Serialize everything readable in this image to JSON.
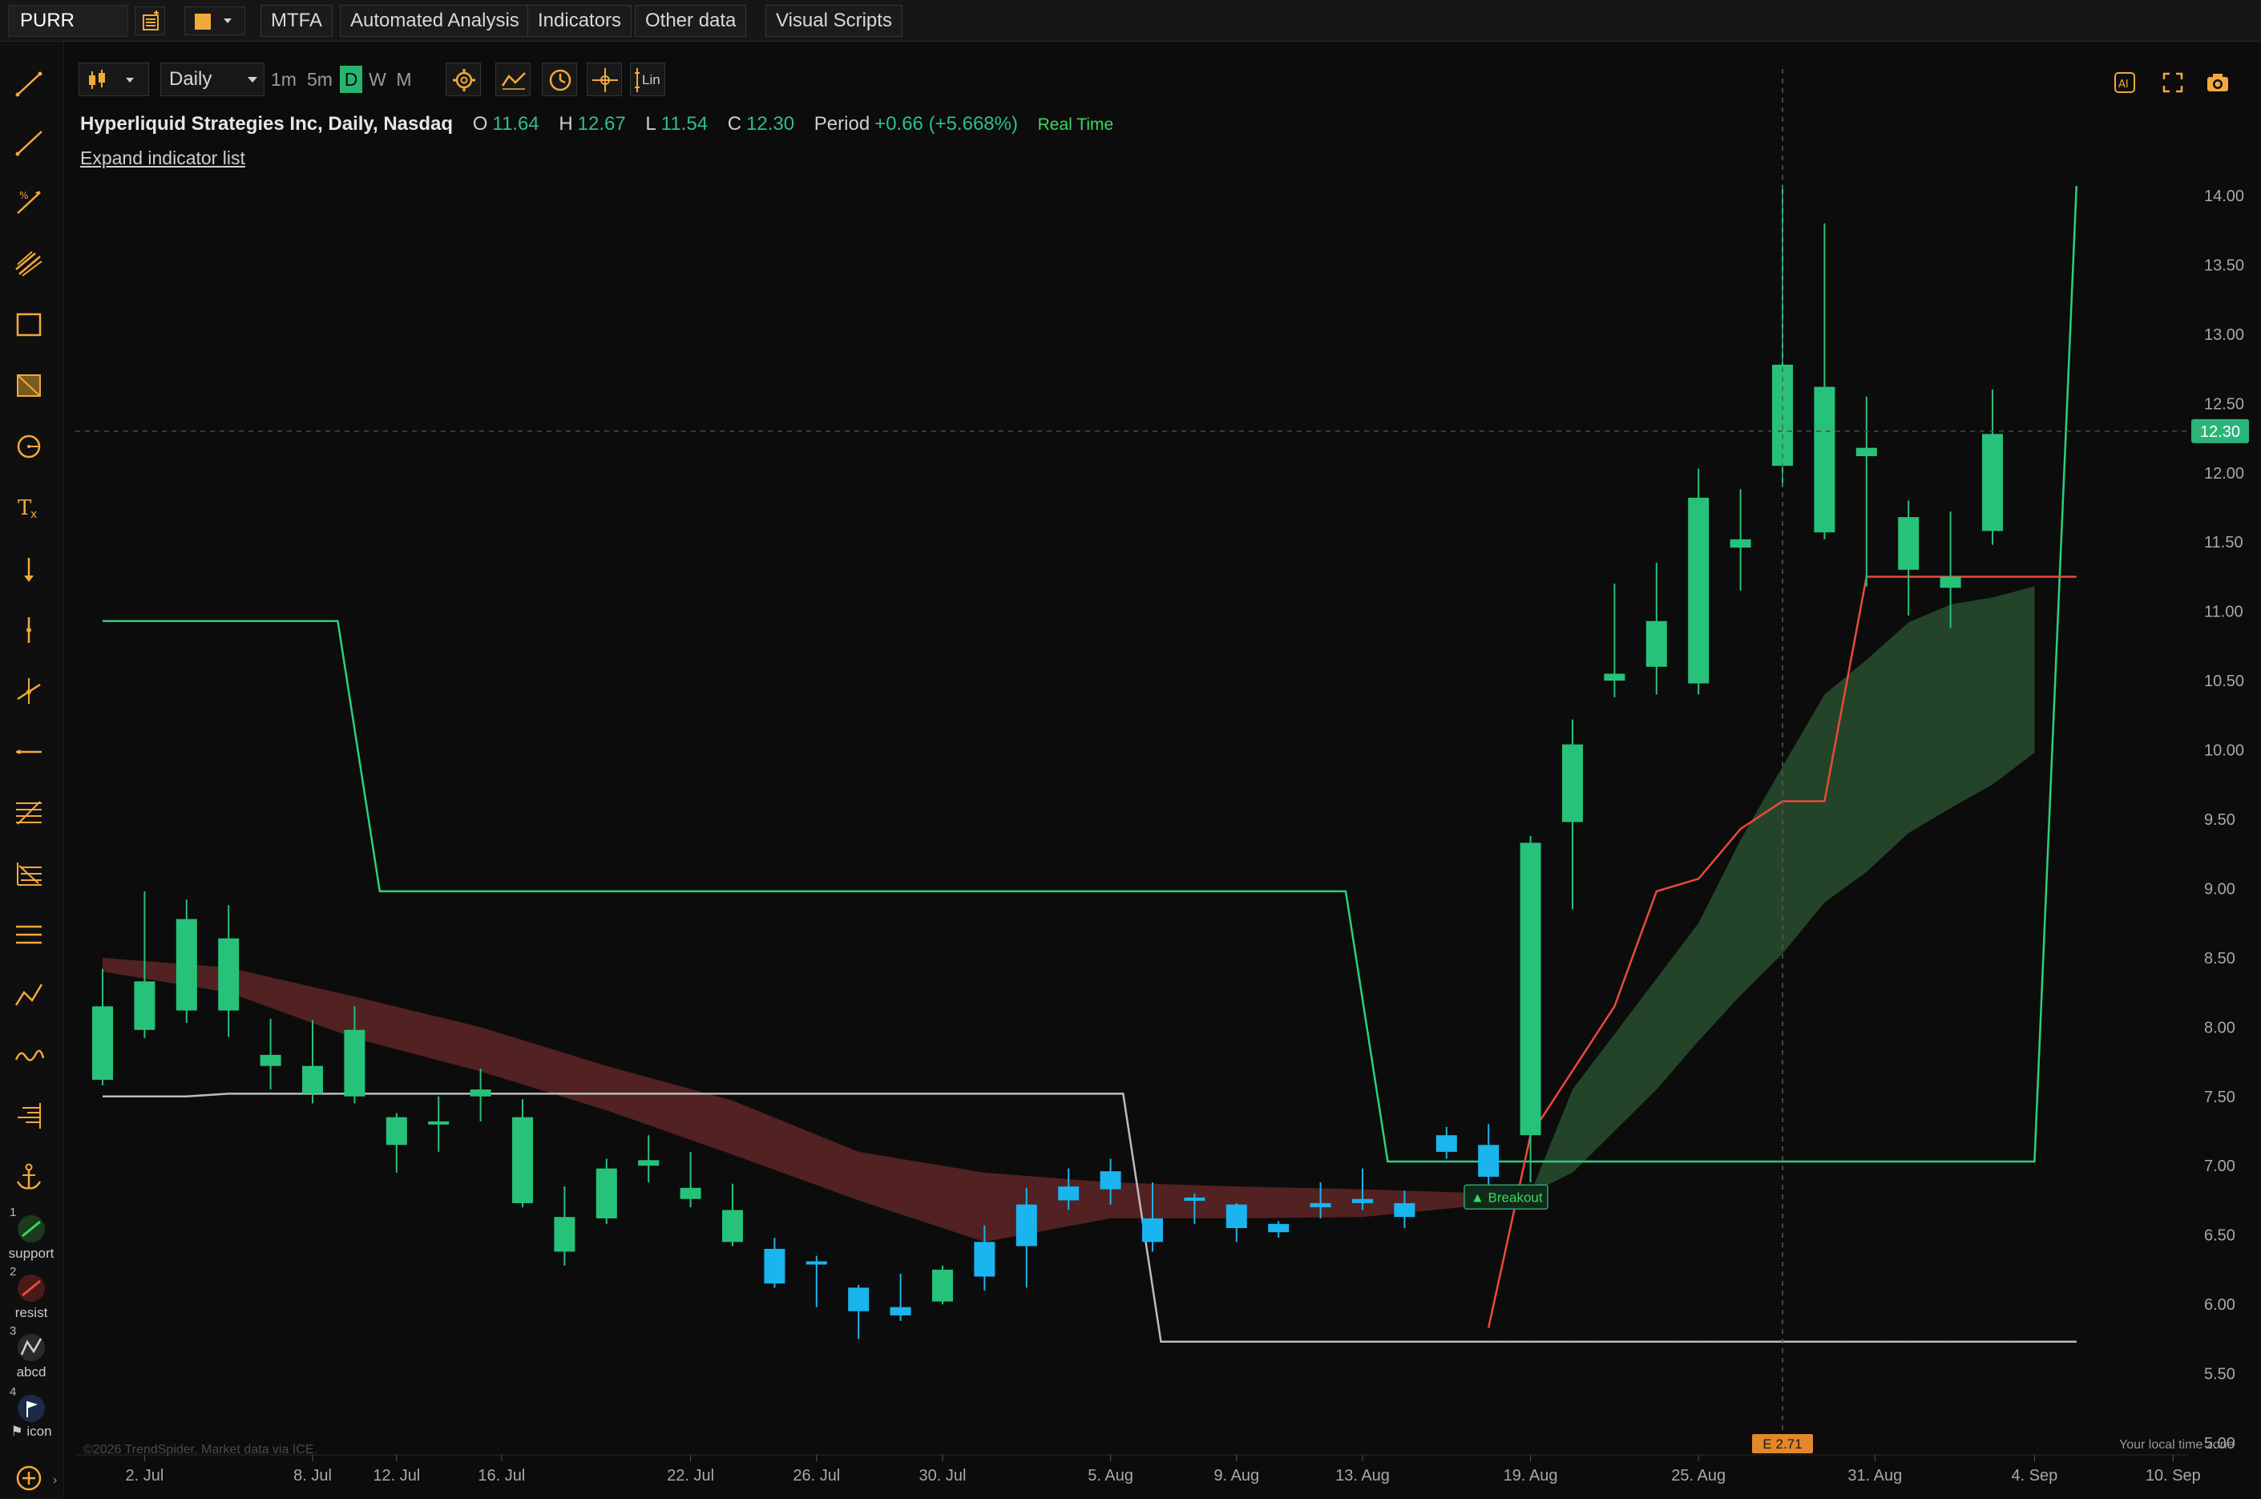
{
  "topbar": {
    "ticker": "PURR",
    "buttons": [
      "MTFA",
      "Automated Analysis",
      "Indicators",
      "Other data",
      "Visual Scripts"
    ]
  },
  "toolbar": {
    "interval": "Daily",
    "timeframes": [
      "1m",
      "5m",
      "D",
      "W",
      "M"
    ],
    "active_timeframe": "D",
    "scale_label": "Lin"
  },
  "info": {
    "name": "Hyperliquid Strategies Inc, Daily, Nasdaq",
    "o_label": "O",
    "o": "11.64",
    "h_label": "H",
    "h": "12.67",
    "l_label": "L",
    "l": "11.54",
    "c_label": "C",
    "c": "12.30",
    "period_label": "Period",
    "period": "+0.66 (+5.668%)",
    "realtime": "Real Time",
    "expand_link": "Expand indicator list"
  },
  "favorites": [
    {
      "num": "1",
      "label": "support"
    },
    {
      "num": "2",
      "label": "resist"
    },
    {
      "num": "3",
      "label": "abcd"
    },
    {
      "num": "4",
      "label": "icon"
    }
  ],
  "footer": {
    "copyright": "©2026 TrendSpider. Market data via ICE.",
    "local_tz": "Your local time zone"
  },
  "colors": {
    "up": "#27c27a",
    "down_blue": "#1ab4ee",
    "cloud_red": "#5a2424",
    "cloud_green": "#274a2c",
    "channel": "#2bd07e",
    "stop_red": "#ea4a3a",
    "gray_line": "#bcbcbc",
    "accent": "#f2a93b"
  },
  "chart_data": {
    "type": "candlestick",
    "ylim": [
      5.0,
      14.2
    ],
    "yticks": [
      "14.00",
      "13.50",
      "13.00",
      "12.50",
      "12.00",
      "11.50",
      "11.00",
      "10.50",
      "10.00",
      "9.50",
      "9.00",
      "8.50",
      "8.00",
      "7.50",
      "7.00",
      "6.50",
      "6.00",
      "5.50",
      "5.00"
    ],
    "xticks": [
      {
        "label": "2. Jul",
        "i": 1
      },
      {
        "label": "8. Jul",
        "i": 5
      },
      {
        "label": "12. Jul",
        "i": 7
      },
      {
        "label": "16. Jul",
        "i": 9.5
      },
      {
        "label": "22. Jul",
        "i": 14
      },
      {
        "label": "26. Jul",
        "i": 17
      },
      {
        "label": "30. Jul",
        "i": 20
      },
      {
        "label": "5. Aug",
        "i": 24
      },
      {
        "label": "9. Aug",
        "i": 27
      },
      {
        "label": "13. Aug",
        "i": 30
      },
      {
        "label": "19. Aug",
        "i": 34
      },
      {
        "label": "25. Aug",
        "i": 38
      },
      {
        "label": "31. Aug",
        "i": 42.2
      },
      {
        "label": "4. Sep",
        "i": 46
      },
      {
        "label": "10. Sep",
        "i": 49.3
      }
    ],
    "candles": [
      {
        "o": 7.62,
        "h": 8.42,
        "l": 7.58,
        "c": 8.15,
        "k": "up"
      },
      {
        "o": 7.98,
        "h": 8.98,
        "l": 7.92,
        "c": 8.33,
        "k": "up"
      },
      {
        "o": 8.12,
        "h": 8.92,
        "l": 8.03,
        "c": 8.78,
        "k": "up"
      },
      {
        "o": 8.12,
        "h": 8.88,
        "l": 7.93,
        "c": 8.64,
        "k": "up"
      },
      {
        "o": 7.8,
        "h": 8.06,
        "l": 7.55,
        "c": 7.72,
        "k": "up"
      },
      {
        "o": 7.52,
        "h": 8.05,
        "l": 7.45,
        "c": 7.72,
        "k": "up"
      },
      {
        "o": 7.5,
        "h": 8.15,
        "l": 7.45,
        "c": 7.98,
        "k": "up"
      },
      {
        "o": 7.35,
        "h": 7.38,
        "l": 6.95,
        "c": 7.15,
        "k": "up"
      },
      {
        "o": 7.3,
        "h": 7.5,
        "l": 7.1,
        "c": 7.32,
        "k": "up"
      },
      {
        "o": 7.55,
        "h": 7.7,
        "l": 7.32,
        "c": 7.5,
        "k": "up"
      },
      {
        "o": 6.73,
        "h": 7.48,
        "l": 6.7,
        "c": 7.35,
        "k": "up"
      },
      {
        "o": 6.63,
        "h": 6.85,
        "l": 6.28,
        "c": 6.38,
        "k": "up"
      },
      {
        "o": 6.62,
        "h": 7.05,
        "l": 6.58,
        "c": 6.98,
        "k": "up"
      },
      {
        "o": 7.0,
        "h": 7.22,
        "l": 6.88,
        "c": 7.04,
        "k": "up"
      },
      {
        "o": 6.76,
        "h": 7.1,
        "l": 6.7,
        "c": 6.84,
        "k": "up"
      },
      {
        "o": 6.68,
        "h": 6.87,
        "l": 6.42,
        "c": 6.45,
        "k": "up"
      },
      {
        "o": 6.4,
        "h": 6.48,
        "l": 6.12,
        "c": 6.15,
        "k": "blue"
      },
      {
        "o": 6.31,
        "h": 6.35,
        "l": 5.98,
        "c": 6.3,
        "k": "blue"
      },
      {
        "o": 6.12,
        "h": 6.14,
        "l": 5.75,
        "c": 5.95,
        "k": "blue"
      },
      {
        "o": 5.92,
        "h": 6.22,
        "l": 5.88,
        "c": 5.98,
        "k": "blue"
      },
      {
        "o": 6.02,
        "h": 6.28,
        "l": 6.0,
        "c": 6.25,
        "k": "up"
      },
      {
        "o": 6.45,
        "h": 6.57,
        "l": 6.1,
        "c": 6.2,
        "k": "blue"
      },
      {
        "o": 6.72,
        "h": 6.84,
        "l": 6.12,
        "c": 6.42,
        "k": "blue"
      },
      {
        "o": 6.85,
        "h": 6.98,
        "l": 6.68,
        "c": 6.75,
        "k": "blue"
      },
      {
        "o": 6.96,
        "h": 7.05,
        "l": 6.72,
        "c": 6.83,
        "k": "blue"
      },
      {
        "o": 6.62,
        "h": 6.88,
        "l": 6.38,
        "c": 6.45,
        "k": "blue"
      },
      {
        "o": 6.77,
        "h": 6.8,
        "l": 6.58,
        "c": 6.76,
        "k": "blue"
      },
      {
        "o": 6.72,
        "h": 6.73,
        "l": 6.45,
        "c": 6.55,
        "k": "blue"
      },
      {
        "o": 6.58,
        "h": 6.6,
        "l": 6.48,
        "c": 6.52,
        "k": "blue"
      },
      {
        "o": 6.73,
        "h": 6.88,
        "l": 6.62,
        "c": 6.7,
        "k": "blue"
      },
      {
        "o": 6.76,
        "h": 6.98,
        "l": 6.68,
        "c": 6.73,
        "k": "blue"
      },
      {
        "o": 6.73,
        "h": 6.82,
        "l": 6.55,
        "c": 6.63,
        "k": "blue"
      },
      {
        "o": 7.22,
        "h": 7.28,
        "l": 7.05,
        "c": 7.1,
        "k": "blue"
      },
      {
        "o": 7.15,
        "h": 7.3,
        "l": 6.85,
        "c": 6.92,
        "k": "blue"
      },
      {
        "o": 7.22,
        "h": 9.38,
        "l": 6.88,
        "c": 9.33,
        "k": "up"
      },
      {
        "o": 9.48,
        "h": 10.22,
        "l": 8.85,
        "c": 10.04,
        "k": "up"
      },
      {
        "o": 10.5,
        "h": 11.2,
        "l": 10.38,
        "c": 10.55,
        "k": "up"
      },
      {
        "o": 10.6,
        "h": 11.35,
        "l": 10.4,
        "c": 10.93,
        "k": "up"
      },
      {
        "o": 10.48,
        "h": 12.03,
        "l": 10.4,
        "c": 11.82,
        "k": "up"
      },
      {
        "o": 11.46,
        "h": 11.88,
        "l": 11.15,
        "c": 11.52,
        "k": "up"
      },
      {
        "o": 12.05,
        "h": 14.07,
        "l": 11.9,
        "c": 12.78,
        "k": "up"
      },
      {
        "o": 11.57,
        "h": 13.8,
        "l": 11.52,
        "c": 12.62,
        "k": "up"
      },
      {
        "o": 12.18,
        "h": 12.55,
        "l": 11.18,
        "c": 12.12,
        "k": "up"
      },
      {
        "o": 11.3,
        "h": 11.8,
        "l": 10.97,
        "c": 11.68,
        "k": "up"
      },
      {
        "o": 11.17,
        "h": 11.72,
        "l": 10.88,
        "c": 11.25,
        "k": "up"
      },
      {
        "o": 11.58,
        "h": 12.6,
        "l": 11.48,
        "c": 12.28,
        "k": "up"
      }
    ],
    "green_channel": [
      [
        0,
        10.93
      ],
      [
        5.6,
        10.93
      ],
      [
        6.6,
        8.98
      ],
      [
        29.6,
        8.98
      ],
      [
        30.6,
        7.03
      ],
      [
        46,
        7.03
      ],
      [
        47,
        14.07
      ]
    ],
    "gray_line": [
      [
        0,
        7.5
      ],
      [
        2,
        7.5
      ],
      [
        3,
        7.52
      ],
      [
        24.3,
        7.52
      ],
      [
        25.2,
        5.73
      ],
      [
        47,
        5.73
      ]
    ],
    "red_stop": [
      [
        33,
        5.83
      ],
      [
        34,
        7.22
      ],
      [
        36,
        8.15
      ],
      [
        37,
        8.98
      ],
      [
        38,
        9.07
      ],
      [
        39,
        9.43
      ],
      [
        40,
        9.63
      ],
      [
        41,
        9.63
      ],
      [
        42,
        11.25
      ],
      [
        47,
        11.25
      ]
    ],
    "red_cloud_top": [
      [
        0,
        8.5
      ],
      [
        3,
        8.43
      ],
      [
        6,
        8.22
      ],
      [
        9,
        8.0
      ],
      [
        12,
        7.72
      ],
      [
        15,
        7.47
      ],
      [
        18,
        7.1
      ],
      [
        21,
        6.95
      ],
      [
        24,
        6.88
      ],
      [
        27,
        6.85
      ],
      [
        30,
        6.83
      ],
      [
        33,
        6.8
      ],
      [
        34,
        6.8
      ]
    ],
    "red_cloud_bottom": [
      [
        0,
        8.4
      ],
      [
        3,
        8.25
      ],
      [
        6,
        7.92
      ],
      [
        9,
        7.68
      ],
      [
        12,
        7.4
      ],
      [
        15,
        7.08
      ],
      [
        18,
        6.75
      ],
      [
        21,
        6.45
      ],
      [
        24,
        6.62
      ],
      [
        27,
        6.62
      ],
      [
        30,
        6.63
      ],
      [
        33,
        6.72
      ],
      [
        34,
        6.8
      ]
    ],
    "green_cloud_top": [
      [
        34,
        6.8
      ],
      [
        35,
        7.55
      ],
      [
        36,
        7.95
      ],
      [
        37,
        8.35
      ],
      [
        38,
        8.75
      ],
      [
        39,
        9.35
      ],
      [
        40,
        9.88
      ],
      [
        41,
        10.4
      ],
      [
        42,
        10.65
      ],
      [
        43,
        10.92
      ],
      [
        44,
        11.05
      ],
      [
        45,
        11.1
      ],
      [
        46,
        11.18
      ]
    ],
    "green_cloud_bottom": [
      [
        34,
        6.8
      ],
      [
        35,
        6.95
      ],
      [
        36,
        7.25
      ],
      [
        37,
        7.55
      ],
      [
        38,
        7.9
      ],
      [
        39,
        8.23
      ],
      [
        40,
        8.53
      ],
      [
        41,
        8.9
      ],
      [
        42,
        9.12
      ],
      [
        43,
        9.4
      ],
      [
        44,
        9.58
      ],
      [
        45,
        9.75
      ],
      [
        46,
        9.98
      ]
    ],
    "breakout_label": "▲ Breakout",
    "breakout_i": 32.5,
    "breakout_y": 6.78,
    "earnings_label": "E 2.71",
    "earnings_i": 40,
    "crosshair_i": 40,
    "last_price_label": "12.30",
    "last_price": 12.3,
    "lin_scale": true
  }
}
